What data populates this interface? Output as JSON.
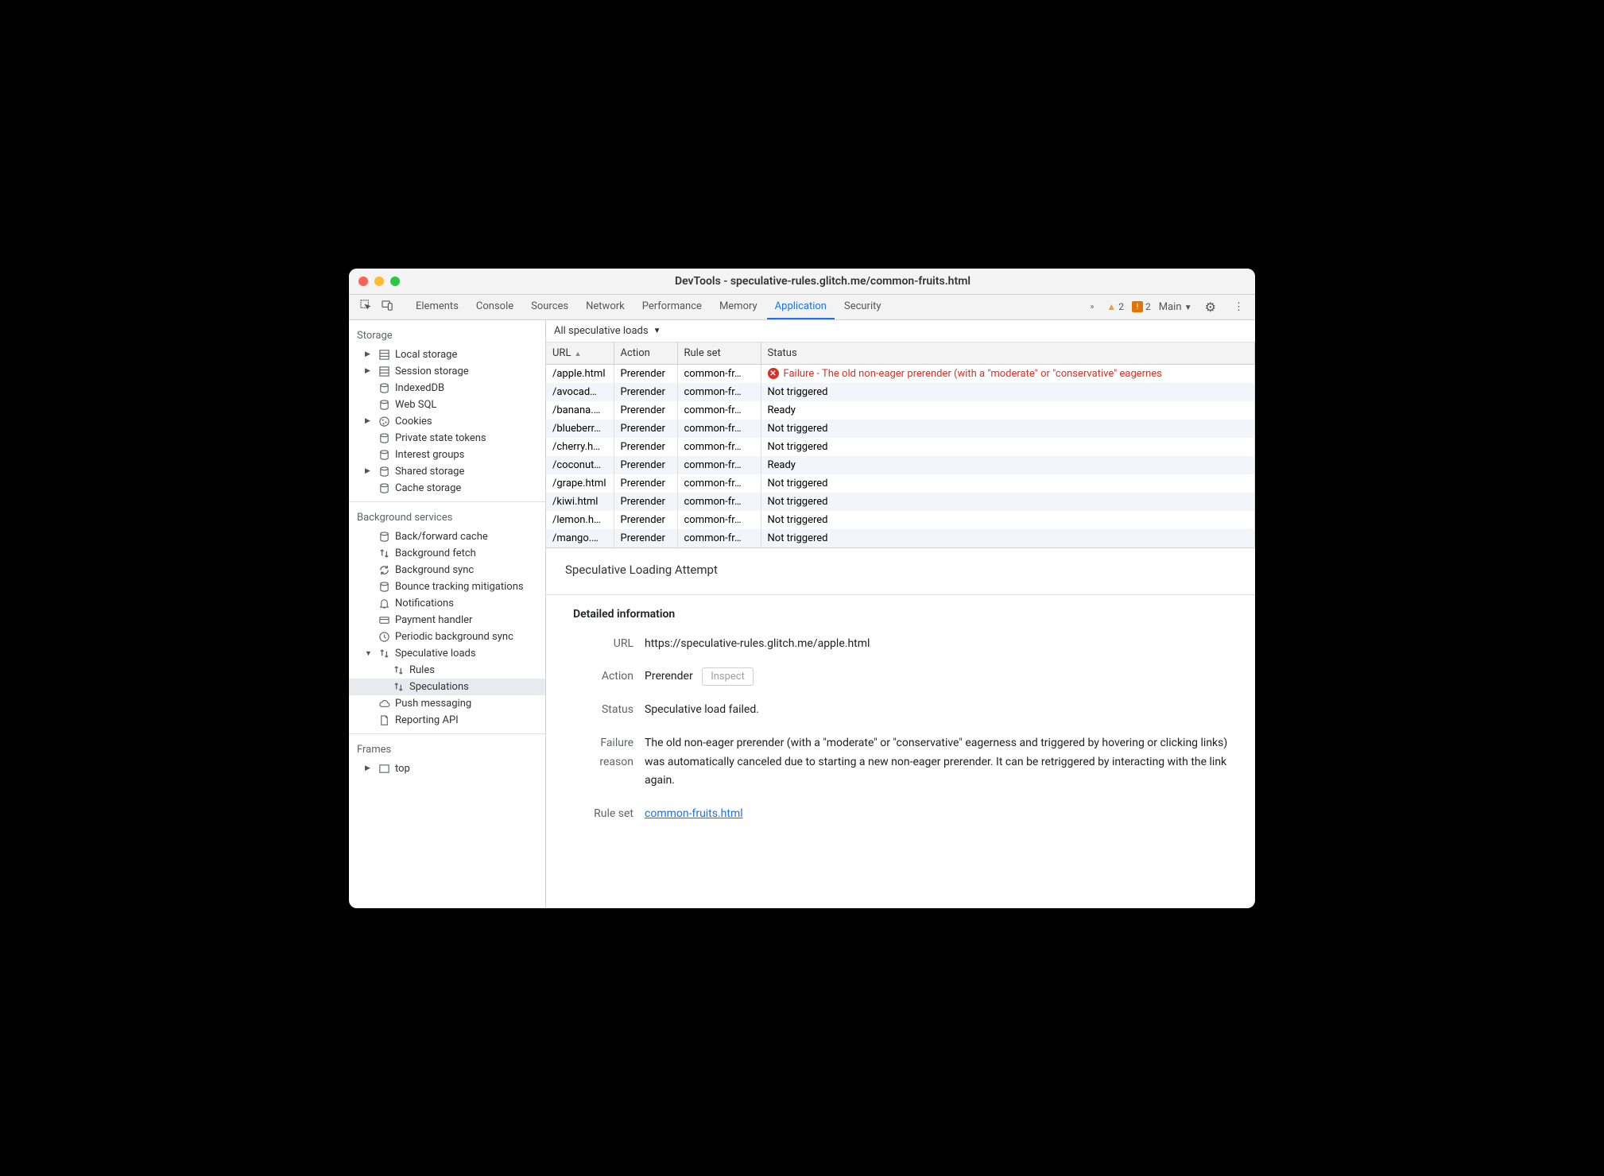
{
  "window_title": "DevTools - speculative-rules.glitch.me/common-fruits.html",
  "toolbar": {
    "tabs": [
      "Elements",
      "Console",
      "Sources",
      "Network",
      "Performance",
      "Memory",
      "Application",
      "Security"
    ],
    "active_tab": "Application",
    "more": "»",
    "warnings_count": "2",
    "errors_count": "2",
    "target": "Main"
  },
  "sidebar": {
    "storage": {
      "title": "Storage",
      "items": [
        {
          "label": "Local storage",
          "icon": "db",
          "expandable": true
        },
        {
          "label": "Session storage",
          "icon": "db",
          "expandable": true
        },
        {
          "label": "IndexedDB",
          "icon": "disk"
        },
        {
          "label": "Web SQL",
          "icon": "disk"
        },
        {
          "label": "Cookies",
          "icon": "cookie",
          "expandable": true
        },
        {
          "label": "Private state tokens",
          "icon": "disk"
        },
        {
          "label": "Interest groups",
          "icon": "disk"
        },
        {
          "label": "Shared storage",
          "icon": "disk",
          "expandable": true
        },
        {
          "label": "Cache storage",
          "icon": "disk"
        }
      ]
    },
    "background": {
      "title": "Background services",
      "items": [
        {
          "label": "Back/forward cache",
          "icon": "disk"
        },
        {
          "label": "Background fetch",
          "icon": "updown"
        },
        {
          "label": "Background sync",
          "icon": "sync"
        },
        {
          "label": "Bounce tracking mitigations",
          "icon": "disk"
        },
        {
          "label": "Notifications",
          "icon": "bell"
        },
        {
          "label": "Payment handler",
          "icon": "card"
        },
        {
          "label": "Periodic background sync",
          "icon": "clock"
        },
        {
          "label": "Speculative loads",
          "icon": "updown",
          "expandable": true,
          "expanded": true,
          "children": [
            {
              "label": "Rules",
              "icon": "updown"
            },
            {
              "label": "Speculations",
              "icon": "updown",
              "selected": true
            }
          ]
        },
        {
          "label": "Push messaging",
          "icon": "cloud"
        },
        {
          "label": "Reporting API",
          "icon": "doc"
        }
      ]
    },
    "frames": {
      "title": "Frames",
      "items": [
        {
          "label": "top",
          "icon": "frame",
          "expandable": true
        }
      ]
    }
  },
  "filter": {
    "label": "All speculative loads"
  },
  "table": {
    "headers": [
      "URL",
      "Action",
      "Rule set",
      "Status"
    ],
    "rows": [
      {
        "url": "/apple.html",
        "action": "Prerender",
        "ruleset": "common-fr…",
        "status": "Failure - The old non-eager prerender (with a \"moderate\" or \"conservative\" eagernes",
        "failure": true
      },
      {
        "url": "/avocad…",
        "action": "Prerender",
        "ruleset": "common-fr…",
        "status": "Not triggered"
      },
      {
        "url": "/banana.…",
        "action": "Prerender",
        "ruleset": "common-fr…",
        "status": "Ready"
      },
      {
        "url": "/blueberr…",
        "action": "Prerender",
        "ruleset": "common-fr…",
        "status": "Not triggered"
      },
      {
        "url": "/cherry.h…",
        "action": "Prerender",
        "ruleset": "common-fr…",
        "status": "Not triggered"
      },
      {
        "url": "/coconut…",
        "action": "Prerender",
        "ruleset": "common-fr…",
        "status": "Ready"
      },
      {
        "url": "/grape.html",
        "action": "Prerender",
        "ruleset": "common-fr…",
        "status": "Not triggered"
      },
      {
        "url": "/kiwi.html",
        "action": "Prerender",
        "ruleset": "common-fr…",
        "status": "Not triggered"
      },
      {
        "url": "/lemon.h…",
        "action": "Prerender",
        "ruleset": "common-fr…",
        "status": "Not triggered"
      },
      {
        "url": "/mango.…",
        "action": "Prerender",
        "ruleset": "common-fr…",
        "status": "Not triggered"
      }
    ]
  },
  "detail": {
    "heading": "Speculative Loading Attempt",
    "section": "Detailed information",
    "url_label": "URL",
    "url_value": "https://speculative-rules.glitch.me/apple.html",
    "action_label": "Action",
    "action_value": "Prerender",
    "inspect_label": "Inspect",
    "status_label": "Status",
    "status_value": "Speculative load failed.",
    "failure_label": "Failure reason",
    "failure_value": "The old non-eager prerender (with a \"moderate\" or \"conservative\" eagerness and triggered by hovering or clicking links) was automatically canceled due to starting a new non-eager prerender. It can be retriggered by interacting with the link again.",
    "ruleset_label": "Rule set",
    "ruleset_value": "common-fruits.html"
  }
}
